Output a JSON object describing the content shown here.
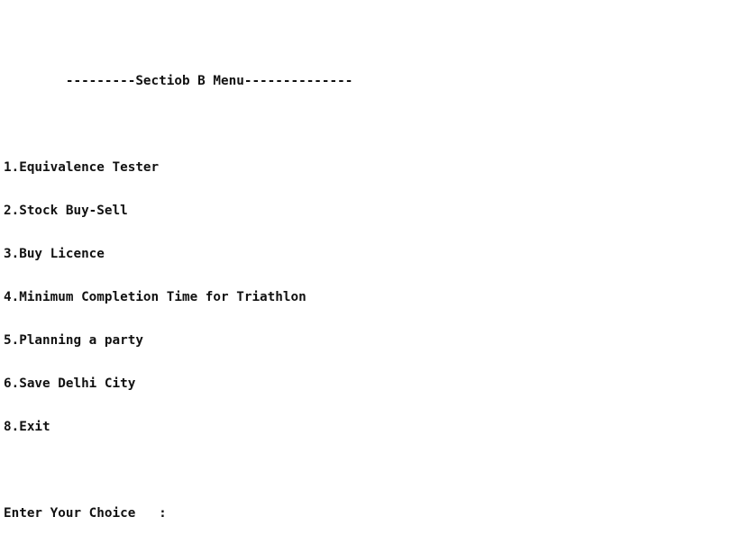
{
  "terminal": {
    "header": "        ---------Sectiob B Menu--------------",
    "menu_items": [
      "1.Equivalence Tester",
      "2.Stock Buy-Sell",
      "3.Buy Licence",
      "4.Minimum Completion Time for Triathlon",
      "5.Planning a party",
      "6.Save Delhi City",
      "8.Exit"
    ],
    "prompt": "Enter Your Choice   :",
    "input_value": ""
  }
}
